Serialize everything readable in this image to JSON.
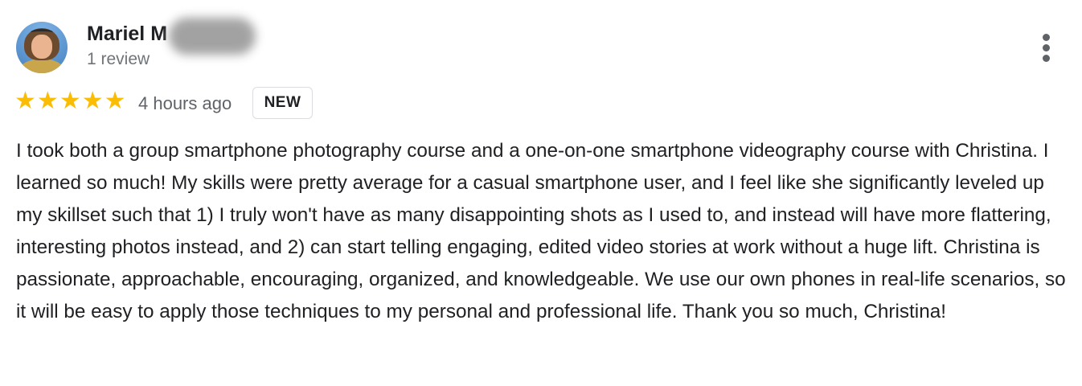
{
  "reviewer": {
    "name": "Mariel M",
    "review_count": "1 review"
  },
  "rating": {
    "stars": 5,
    "max_stars": 5,
    "star_color": "#fbbc04"
  },
  "timestamp": "4 hours ago",
  "badge": "NEW",
  "review_text": "I took both a group smartphone photography course and a one-on-one smartphone videography course with Christina. I learned so much! My skills were pretty average for a casual smartphone user, and I feel like she significantly leveled up my skillset such that 1) I truly won't have as many disappointing shots as I used to, and instead will have more flattering, interesting photos instead, and 2) can start telling engaging, edited video stories at work without a huge lift. Christina is passionate, approachable, encouraging, organized, and knowledgeable. We use our own phones in real-life scenarios, so it will be easy to apply those techniques to my personal and professional life. Thank you so much, Christina!",
  "icons": {
    "more": "more-vert-icon",
    "star": "star-icon"
  }
}
